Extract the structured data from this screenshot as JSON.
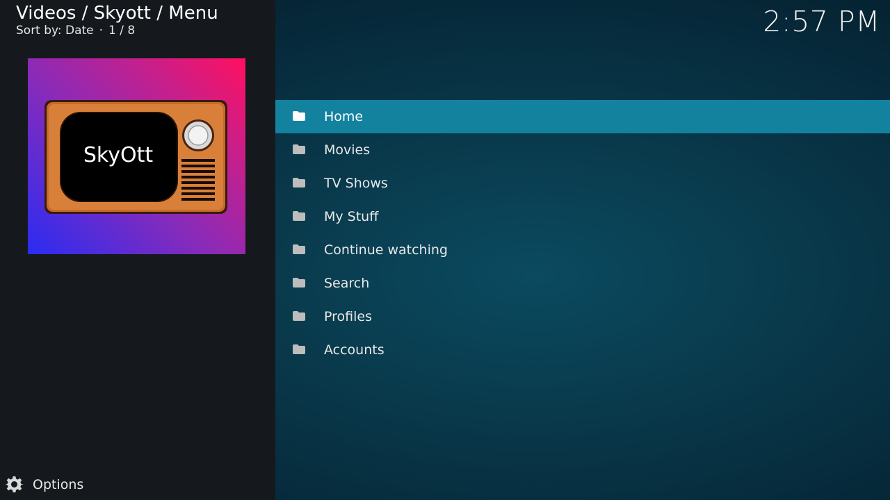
{
  "header": {
    "breadcrumb": "Videos / Skyott / Menu",
    "sort_label": "Sort by: Date",
    "separator": "·",
    "position": "1 / 8"
  },
  "clock": "2:57 PM",
  "thumbnail": {
    "label": "SkyOtt",
    "icon": "retro-tv-icon"
  },
  "menu": {
    "focused_index": 0,
    "items": [
      {
        "label": "Home",
        "icon": "folder-icon"
      },
      {
        "label": "Movies",
        "icon": "folder-icon"
      },
      {
        "label": "TV Shows",
        "icon": "folder-icon"
      },
      {
        "label": "My Stuff",
        "icon": "folder-icon"
      },
      {
        "label": "Continue watching",
        "icon": "folder-icon"
      },
      {
        "label": "Search",
        "icon": "folder-icon"
      },
      {
        "label": "Profiles",
        "icon": "folder-icon"
      },
      {
        "label": "Accounts",
        "icon": "folder-icon"
      }
    ]
  },
  "footer": {
    "options_label": "Options",
    "options_icon": "gear-icon"
  },
  "colors": {
    "accent": "#12829f",
    "panel": "#15191d",
    "background": "#093a4c"
  }
}
